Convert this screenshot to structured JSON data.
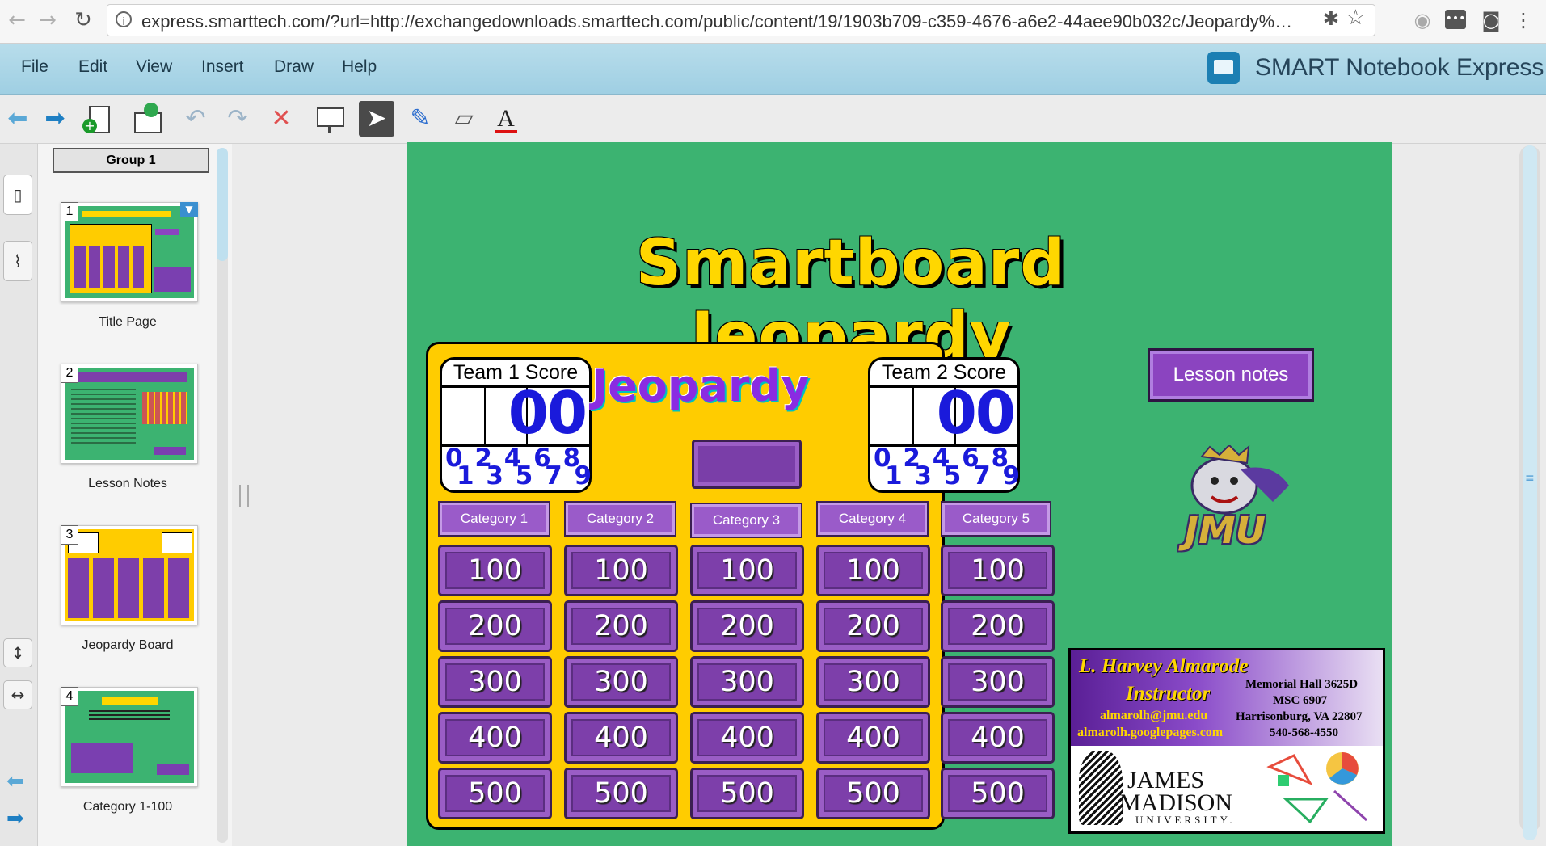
{
  "browser": {
    "url": "express.smarttech.com/?url=http://exchangedownloads.smarttech.com/public/content/19/1903b709-c359-4676-a6e2-44aee90b032c/Jeopardy%…"
  },
  "menu": {
    "items": [
      "File",
      "Edit",
      "View",
      "Insert",
      "Draw",
      "Help"
    ],
    "brand": "SMART Notebook Express"
  },
  "sorter": {
    "group": "Group 1",
    "pages": [
      {
        "num": "1",
        "label": "Title Page"
      },
      {
        "num": "2",
        "label": "Lesson Notes"
      },
      {
        "num": "3",
        "label": "Jeopardy Board"
      },
      {
        "num": "4",
        "label": "Category 1-100"
      }
    ]
  },
  "slide": {
    "title": "Smartboard Jeopardy",
    "board_title": "Jeopardy",
    "team1": {
      "label": "Team 1 Score",
      "score": "00",
      "digits_top": "0 2 4 6 8",
      "digits_bottom": "1 3 5 7 9"
    },
    "team2": {
      "label": "Team 2 Score",
      "score": "00",
      "digits_top": "0 2 4 6 8",
      "digits_bottom": "1 3 5 7 9"
    },
    "categories": [
      "Category 1",
      "Category 2",
      "Category 3",
      "Category 4",
      "Category 5"
    ],
    "values": [
      "100",
      "200",
      "300",
      "400",
      "500"
    ],
    "lesson_notes": "Lesson notes",
    "logo_text": "JMU",
    "card": {
      "name": "L. Harvey Almarode",
      "role": "Instructor",
      "email": "almarolh@jmu.edu",
      "site": "almarolh.googlepages.com",
      "addr1": "Memorial Hall 3625D",
      "addr2": "MSC 6907",
      "addr3": "Harrisonburg, VA 22807",
      "phone": "540-568-4550",
      "uni1": "JAMES",
      "uni2": "MADISON",
      "uni3": "UNIVERSITY."
    }
  },
  "colors": {
    "slide_bg": "#3cb371",
    "board_bg": "#ffcc00",
    "tile": "#7d3faa",
    "score": "#1a1adb"
  }
}
